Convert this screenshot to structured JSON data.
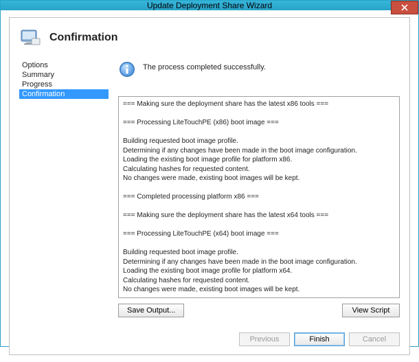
{
  "window": {
    "title": "Update Deployment Share Wizard"
  },
  "page": {
    "heading": "Confirmation"
  },
  "nav": {
    "items": [
      {
        "label": "Options",
        "selected": false
      },
      {
        "label": "Summary",
        "selected": false
      },
      {
        "label": "Progress",
        "selected": false
      },
      {
        "label": "Confirmation",
        "selected": true
      }
    ]
  },
  "status": {
    "message": "The process completed successfully."
  },
  "log": "=== Making sure the deployment share has the latest x86 tools ===\n\n=== Processing LiteTouchPE (x86) boot image ===\n\nBuilding requested boot image profile.\nDetermining if any changes have been made in the boot image configuration.\nLoading the existing boot image profile for platform x86.\nCalculating hashes for requested content.\nNo changes were made, existing boot images will be kept.\n\n=== Completed processing platform x86 ===\n\n=== Making sure the deployment share has the latest x64 tools ===\n\n=== Processing LiteTouchPE (x64) boot image ===\n\nBuilding requested boot image profile.\nDetermining if any changes have been made in the boot image configuration.\nLoading the existing boot image profile for platform x64.\nCalculating hashes for requested content.\nNo changes were made, existing boot images will be kept.",
  "buttons": {
    "saveOutput": "Save Output...",
    "viewScript": "View Script",
    "previous": "Previous",
    "finish": "Finish",
    "cancel": "Cancel"
  }
}
